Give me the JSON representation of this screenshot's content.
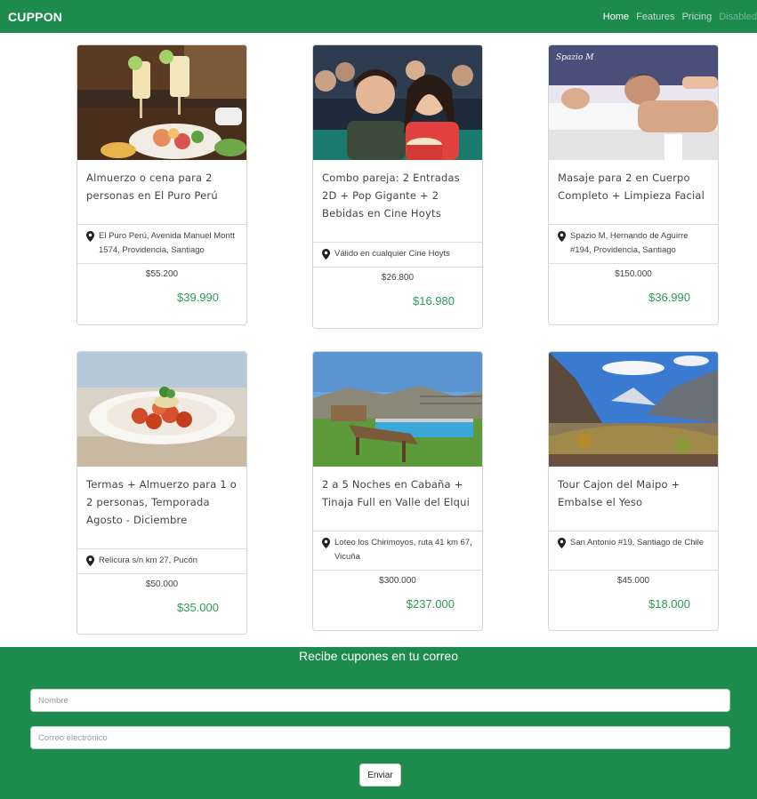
{
  "nav": {
    "brand": "CUPPON",
    "links": [
      "Home",
      "Features",
      "Pricing",
      "Disabled"
    ]
  },
  "cards": [
    {
      "image": "food-plate-photo",
      "title": "Almuerzo o cena para 2 personas en El Puro Perú",
      "location": "El Puro Perú, Avenida Manuel Montt 1574, Providencia, Santiago",
      "price_old": "$55.200",
      "price_new": "$39.990"
    },
    {
      "image": "cinema-couple-photo",
      "title": "Combo pareja: 2 Entradas 2D + Pop Gigante + 2 Bebidas en Cine Hoyts",
      "location": "Válido en cualquier Cine Hoyts",
      "price_old": "$26.800",
      "price_new": "$16.980"
    },
    {
      "image": "massage-photo",
      "title": "Masaje para 2 en Cuerpo Completo + Limpieza Facial",
      "location": "Spazio M, Hernando de Aguirre #194, Providencia, Santiago",
      "price_old": "$150.000",
      "price_new": "$36.990"
    },
    {
      "image": "pasta-photo",
      "title": "Termas + Almuerzo para 1 o 2 personas, Temporada Agosto - Diciembre",
      "location": "Relicura s/n km 27, Pucón",
      "price_old": "$50.000",
      "price_new": "$35.000"
    },
    {
      "image": "pool-cabin-photo",
      "title": "2 a 5 Noches en Cabaña + Tinaja Full en Valle del Elqui",
      "location": "Loteo los Chirimoyos, ruta 41 km 67, Vicuña",
      "price_old": "$300.000",
      "price_new": "$237.000"
    },
    {
      "image": "mountain-valley-photo",
      "title": "Tour Cajon del Maipo + Embalse el Yeso",
      "location": "San Antonio #19, Santiago de Chile",
      "price_old": "$45.000",
      "price_new": "$18.000"
    }
  ],
  "subscribe": {
    "title": "Recibe cupones en tu correo",
    "name_placeholder": "Nombre",
    "email_placeholder": "Correo electrónico",
    "submit_label": "Enviar"
  },
  "colors": {
    "brand_green": "#1d8a4e",
    "price_green": "#2e9a55"
  }
}
